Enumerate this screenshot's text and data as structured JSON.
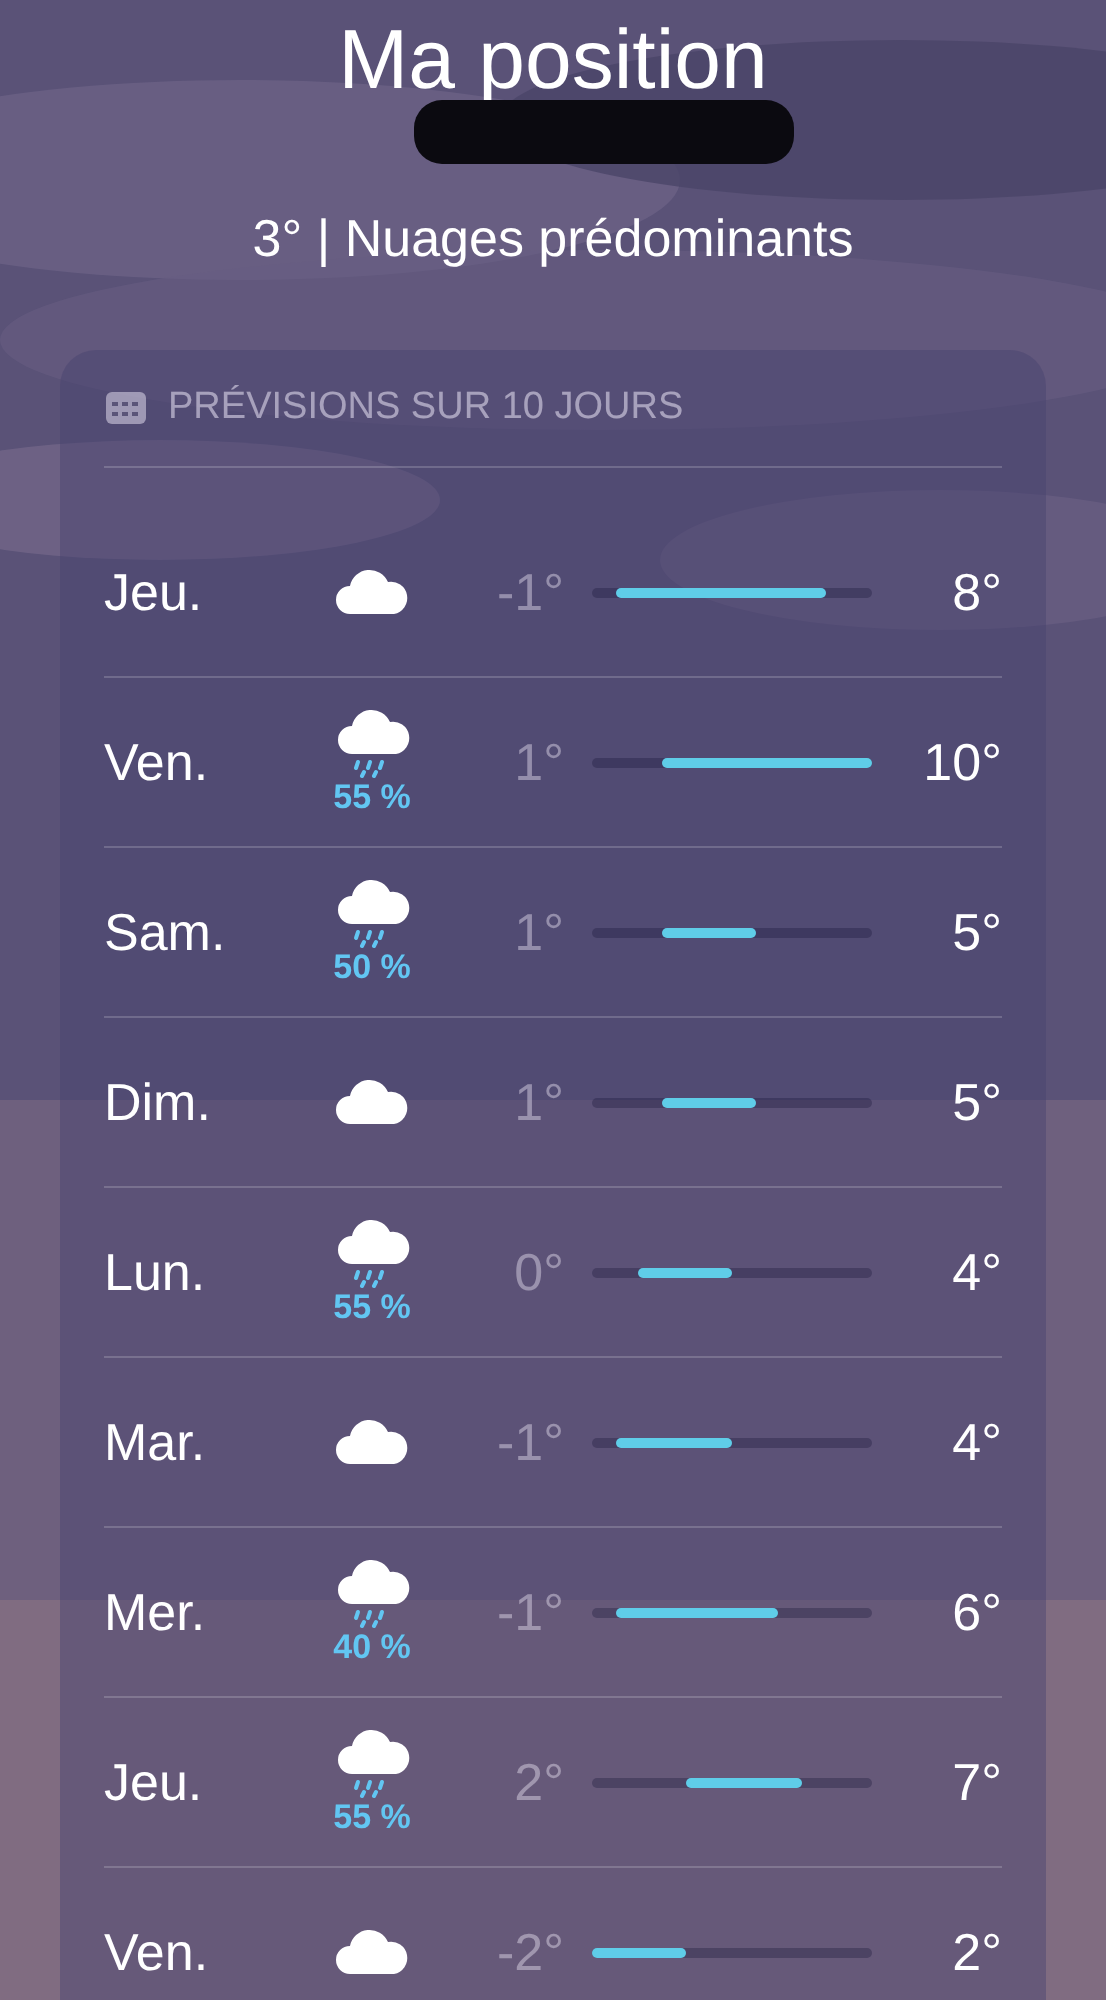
{
  "location": {
    "title": "Ma position",
    "summary": "3° | Nuages prédominants"
  },
  "forecast": {
    "title": "PRÉVISIONS SUR 10 JOURS",
    "days": [
      {
        "day": "Jeu.",
        "kind": "cloud",
        "low": "-1°",
        "high": "8°"
      },
      {
        "day": "Ven.",
        "kind": "rain",
        "precip": "55 %",
        "low": "1°",
        "high": "10°"
      },
      {
        "day": "Sam.",
        "kind": "rain",
        "precip": "50 %",
        "low": "1°",
        "high": "5°"
      },
      {
        "day": "Dim.",
        "kind": "cloud",
        "low": "1°",
        "high": "5°"
      },
      {
        "day": "Lun.",
        "kind": "rain",
        "precip": "55 %",
        "low": "0°",
        "high": "4°"
      },
      {
        "day": "Mar.",
        "kind": "cloud",
        "low": "-1°",
        "high": "4°"
      },
      {
        "day": "Mer.",
        "kind": "rain",
        "precip": "40 %",
        "low": "-1°",
        "high": "6°"
      },
      {
        "day": "Jeu.",
        "kind": "rain",
        "precip": "55 %",
        "low": "2°",
        "high": "7°"
      },
      {
        "day": "Ven.",
        "kind": "cloud",
        "low": "-2°",
        "high": "2°"
      }
    ]
  }
}
